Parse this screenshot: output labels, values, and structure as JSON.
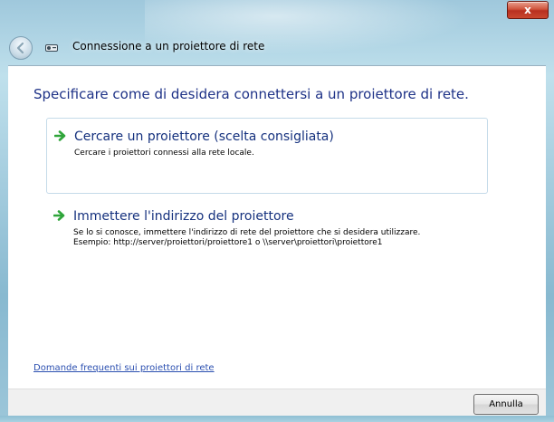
{
  "window": {
    "title": "Connessione a un proiettore di rete",
    "close_label": "x"
  },
  "content": {
    "heading": "Specificare come di desidera connettersi a un proiettore di rete.",
    "options": [
      {
        "title": "Cercare un proiettore (scelta consigliata)",
        "description_lines": [
          "Cercare i proiettori connessi alla rete locale."
        ],
        "icon": "green-arrow-icon"
      },
      {
        "title": "Immettere l'indirizzo del proiettore",
        "description_lines": [
          "Se lo si conosce, immettere l'indirizzo di rete del proiettore che si desidera utilizzare.",
          "Esempio: http://server/proiettori/proiettore1 o \\\\server\\proiettori\\proiettore1"
        ],
        "icon": "green-arrow-icon"
      }
    ],
    "faq_link": "Domande frequenti sui proiettori di rete"
  },
  "footer": {
    "cancel_label": "Annulla"
  },
  "colors": {
    "heading": "#1e3287",
    "link": "#2b4fb0",
    "arrow": "#2fa53a"
  }
}
